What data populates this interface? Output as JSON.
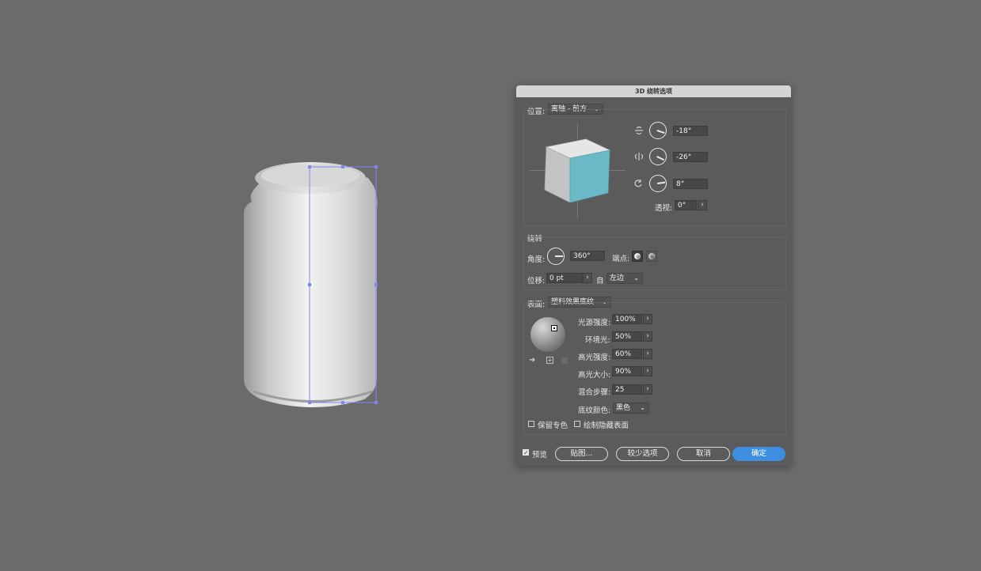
{
  "dialog": {
    "title": "3D 绕转选项",
    "position": {
      "label": "位置:",
      "value": "离轴 - 前方"
    },
    "rotation": {
      "x_value": "-18°",
      "y_value": "-26°",
      "z_value": "8°",
      "perspective_label": "透视:",
      "perspective_value": "0°"
    },
    "revolve": {
      "section_label": "绕转",
      "angle_label": "角度:",
      "angle_value": "360°",
      "cap_label": "端点:",
      "offset_label": "位移:",
      "offset_value": "0 pt",
      "from_label": "自",
      "from_value": "左边"
    },
    "surface": {
      "label": "表面:",
      "value": "塑料效果底纹",
      "light_intensity_label": "光源强度:",
      "light_intensity_value": "100%",
      "ambient_label": "环境光:",
      "ambient_value": "50%",
      "highlight_intensity_label": "高光强度:",
      "highlight_intensity_value": "60%",
      "highlight_size_label": "高光大小:",
      "highlight_size_value": "90%",
      "blend_steps_label": "混合步骤:",
      "blend_steps_value": "25",
      "shading_color_label": "底纹颜色:",
      "shading_color_value": "黑色"
    },
    "options": {
      "preserve_spot_label": "保留专色",
      "draw_hidden_label": "绘制隐藏表面",
      "preview_label": "预览"
    },
    "buttons": {
      "map": "贴图...",
      "fewer_options": "较少选项",
      "cancel": "取消",
      "ok": "确定"
    },
    "colors": {
      "cube_face": "#6bb8c6",
      "primary_button": "#3d8ee0"
    }
  }
}
